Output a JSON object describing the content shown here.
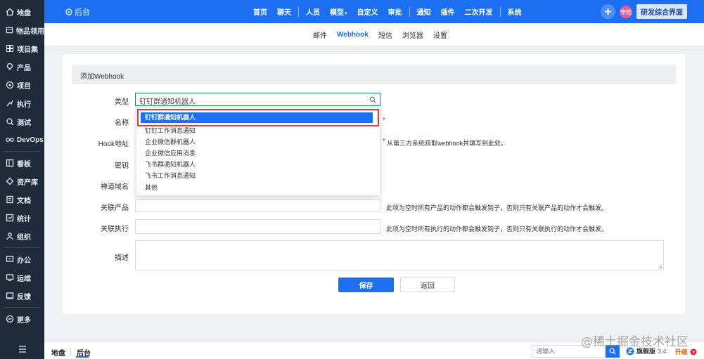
{
  "sidebar": {
    "items": [
      {
        "label": "地盘",
        "icon": "home-icon"
      },
      {
        "label": "物品领用",
        "icon": "box-icon"
      },
      {
        "label": "项目集",
        "icon": "grid-icon"
      },
      {
        "label": "产品",
        "icon": "lightbulb-icon"
      },
      {
        "label": "项目",
        "icon": "target-icon"
      },
      {
        "label": "执行",
        "icon": "run-icon"
      },
      {
        "label": "测试",
        "icon": "search-bug-icon"
      },
      {
        "label": "DevOps",
        "icon": "infinity-icon"
      },
      {
        "label": "看板",
        "icon": "kanban-icon"
      },
      {
        "label": "资产库",
        "icon": "diamond-icon"
      },
      {
        "label": "文档",
        "icon": "document-icon"
      },
      {
        "label": "统计",
        "icon": "chart-icon"
      },
      {
        "label": "组织",
        "icon": "people-icon"
      },
      {
        "label": "办公",
        "icon": "office-icon"
      },
      {
        "label": "运维",
        "icon": "monitor-icon"
      },
      {
        "label": "反馈",
        "icon": "feedback-icon"
      },
      {
        "label": "更多",
        "icon": "more-icon"
      }
    ],
    "menu_icon": "hamburger-icon"
  },
  "topbar": {
    "back_label": "后台",
    "nav": [
      "首页",
      "聊天",
      "人员",
      "模型",
      "自定义",
      "审批",
      "通知",
      "插件",
      "二次开发",
      "系统"
    ],
    "avatar_text": "李皓",
    "switch_label": "研发综合界面"
  },
  "subtabs": [
    "邮件",
    "Webhook",
    "短信",
    "浏览器",
    "设置"
  ],
  "active_subtab": "Webhook",
  "form": {
    "title": "添加Webhook",
    "labels": {
      "type": "类型",
      "name": "名称",
      "hook_url": "Hook地址",
      "secret": "密钥",
      "domain": "禅道域名",
      "product": "关联产品",
      "execution": "关联执行",
      "description": "描述"
    },
    "type_value": "钉钉群通知机器人",
    "dropdown_options": [
      "钉钉群通知机器人",
      "钉钉工作消息通知",
      "企业微信群机器人",
      "企业微信应用消息",
      "飞书群通知机器人",
      "飞书工作消息通知",
      "其他"
    ],
    "required_mark": "*",
    "hook_hint": "从第三方系统获取webhook并填写到此处。",
    "product_hint": "此项为空时所有产品的动作都会触发钩子，否则只有关联产品的动作才会触发。",
    "execution_hint": "此项为空时所有执行的动作都会触发钩子，否则只有关联执行的动作才会触发。",
    "save_label": "保存",
    "back_label": "返回"
  },
  "bottombar": {
    "crumbs": [
      "地盘",
      "后台"
    ],
    "search_placeholder": "请输入",
    "edition_label": "旗舰版",
    "edition_version": "3.4",
    "upgrade_label": "升级"
  },
  "watermark": "@稀土掘金技术社区",
  "colors": {
    "primary": "#1b6ff0",
    "sidebar": "#1f2a3a",
    "highlight_outline": "#e03a3a"
  }
}
